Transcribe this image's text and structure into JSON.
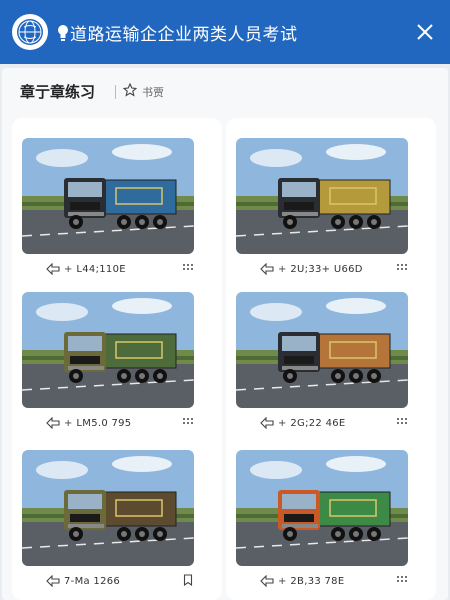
{
  "header": {
    "title": "道路运输企企业两类人员考试",
    "logo_icon": "globe-logo-icon",
    "bulb_icon": "lightbulb-icon",
    "close_icon": "close-icon",
    "color": "#2167c0"
  },
  "subheader": {
    "title": "章亍章练习",
    "bookmark_icon": "star-icon",
    "bookmark_label": "书贾"
  },
  "cards": [
    {
      "column": "left",
      "code": "L44;110E",
      "prefix": "+",
      "action_icon": "dots-grid-icon",
      "truck": "dark",
      "cargo": "#2f6b9c"
    },
    {
      "column": "right",
      "code": "2U;33+ U66D",
      "prefix": "+",
      "action_icon": "dots-grid-icon",
      "truck": "dark",
      "cargo": "#b59a3c"
    },
    {
      "column": "left",
      "code": "LM5.0 795",
      "prefix": "+",
      "action_icon": "dots-grid-icon",
      "truck": "olive",
      "cargo": "#4e6b3b"
    },
    {
      "column": "right",
      "code": "2G;22 46E",
      "prefix": "+",
      "action_icon": "dots-grid-icon",
      "truck": "dark",
      "cargo": "#b5743a"
    },
    {
      "column": "left",
      "code": "7-Ma 1266",
      "prefix": "",
      "action_icon": "bookmark-icon",
      "truck": "olive",
      "cargo": "#5c4b2f"
    },
    {
      "column": "right",
      "code": "2B,33 78E",
      "prefix": "+",
      "action_icon": "dots-grid-icon",
      "truck": "orange",
      "cargo": "#3c8a45"
    }
  ]
}
